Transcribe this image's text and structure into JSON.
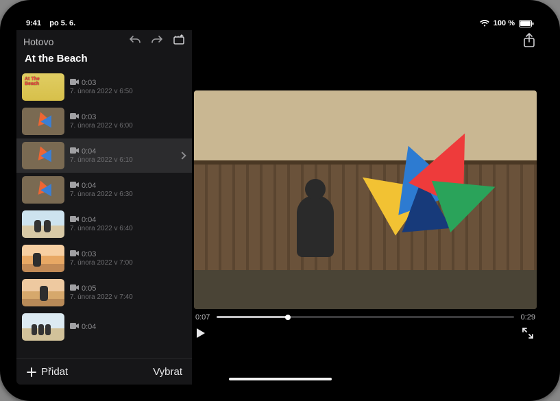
{
  "status": {
    "time": "9:41",
    "date": "po 5. 6.",
    "battery": "100 %"
  },
  "toolbar": {
    "done": "Hotovo"
  },
  "project": {
    "title": "At the Beach"
  },
  "clips": [
    {
      "duration": "0:03",
      "timestamp": "7. února 2022 v 6:50",
      "thumb": "th-title",
      "titleOverlay": "At The\nBeach"
    },
    {
      "duration": "0:03",
      "timestamp": "7. února 2022 v 6:00",
      "thumb": "th-kite"
    },
    {
      "duration": "0:04",
      "timestamp": "7. února 2022 v 6:10",
      "thumb": "th-kite",
      "selected": true
    },
    {
      "duration": "0:04",
      "timestamp": "7. února 2022 v 6:30",
      "thumb": "th-kite"
    },
    {
      "duration": "0:04",
      "timestamp": "7. února 2022 v 6:40",
      "thumb": "th-beach"
    },
    {
      "duration": "0:03",
      "timestamp": "7. února 2022 v 7:00",
      "thumb": "th-sunset"
    },
    {
      "duration": "0:05",
      "timestamp": "7. února 2022 v 7:40",
      "thumb": "th-sunset2"
    },
    {
      "duration": "0:04",
      "timestamp": "",
      "thumb": "th-fam"
    }
  ],
  "sidebarActions": {
    "add": "Přidat",
    "select": "Vybrat"
  },
  "player": {
    "current": "0:07",
    "total": "0:29"
  }
}
